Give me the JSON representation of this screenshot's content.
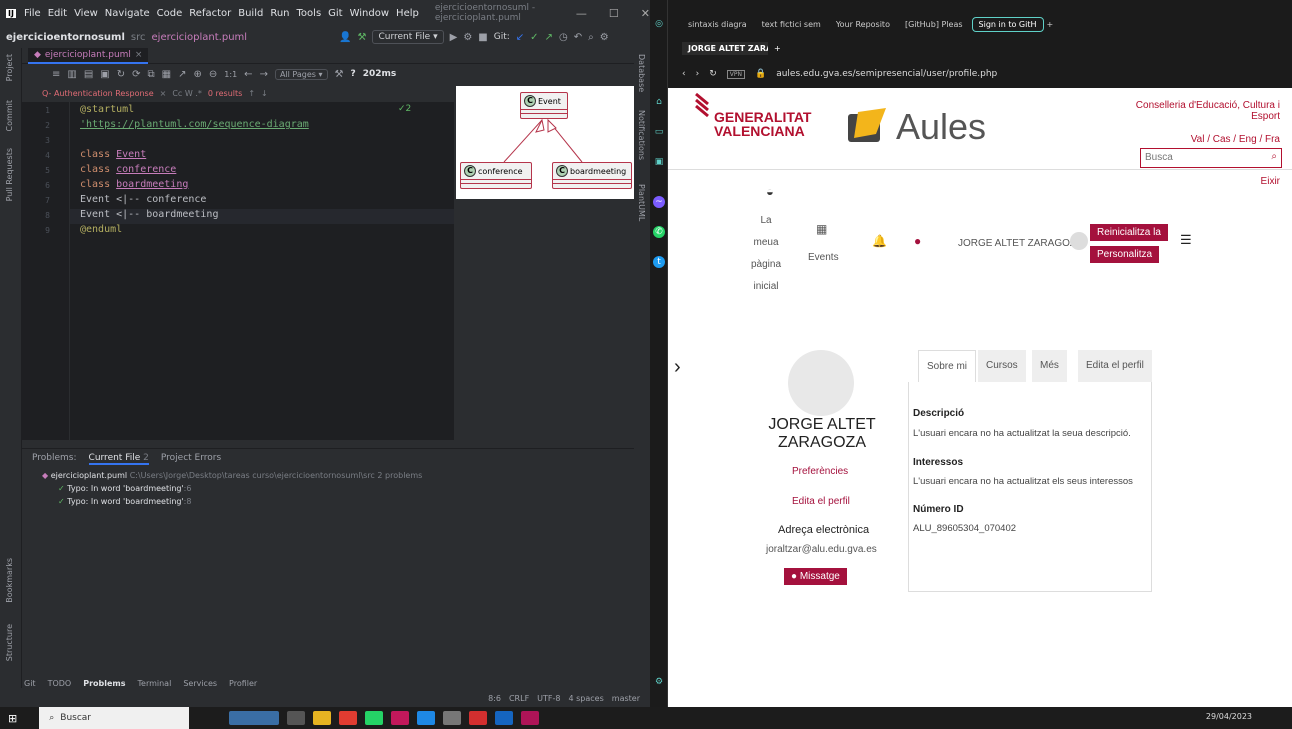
{
  "ide": {
    "menu": [
      "File",
      "Edit",
      "View",
      "Navigate",
      "Code",
      "Refactor",
      "Build",
      "Run",
      "Tools",
      "Git",
      "Window",
      "Help"
    ],
    "window_title": "ejercicioentornosuml - ejercicioplant.puml",
    "project": "ejercicioentornosuml",
    "src": "src",
    "file": "ejercicioplant.puml",
    "current_file": "Current File",
    "git_label": "Git:",
    "tab": "ejercicioplant.puml",
    "all_pages": "All Pages",
    "zoom": "?",
    "render_time": "202ms",
    "search_query": "Q- Authentication Response",
    "search_opts": "Cc W .*",
    "search_results": "0 results",
    "lines": [
      {
        "n": "1",
        "t": "@startuml",
        "c": "ann"
      },
      {
        "n": "2",
        "t": "'https://plantuml.com/sequence-diagram",
        "c": "str"
      },
      {
        "n": "3",
        "t": "",
        "c": "pl"
      },
      {
        "n": "4",
        "t": "class ",
        "c": "kw",
        "x": "Event"
      },
      {
        "n": "5",
        "t": "class ",
        "c": "kw",
        "x": "conference"
      },
      {
        "n": "6",
        "t": "class ",
        "c": "kw",
        "x": "boardmeeting"
      },
      {
        "n": "7",
        "t": "Event <|-- conference",
        "c": "pl"
      },
      {
        "n": "8",
        "t": "Event <|-- boardmeeting",
        "c": "pl"
      },
      {
        "n": "9",
        "t": "@enduml",
        "c": "ann"
      }
    ],
    "checks": "✓2",
    "diagram": {
      "event": "Event",
      "conference": "conference",
      "boardmeeting": "boardmeeting",
      "class_letter": "C"
    },
    "problems": {
      "label": "Problems:",
      "tab_current": "Current File",
      "current_count": "2",
      "tab_project": "Project Errors",
      "file_row": "ejercicioplant.puml",
      "file_path": "C:\\Users\\Jorge\\Desktop\\tareas curso\\ejercicioentornosuml\\src",
      "file_count": "2 problems",
      "items": [
        {
          "msg": "Typo: In word 'boardmeeting'",
          "loc": ":6"
        },
        {
          "msg": "Typo: In word 'boardmeeting'",
          "loc": ":8"
        }
      ]
    },
    "bottom_tabs": [
      "Git",
      "TODO",
      "Problems",
      "Terminal",
      "Services",
      "Profiler"
    ],
    "status": [
      "8:6",
      "CRLF",
      "UTF-8",
      "4 spaces",
      "master"
    ],
    "left_labels": [
      "Project",
      "Commit",
      "Pull Requests",
      "Bookmarks",
      "Structure"
    ],
    "right_labels": [
      "Database",
      "Notifications",
      "PlantUML"
    ]
  },
  "browser": {
    "tabs": [
      "sintaxis diagra",
      "text fictici sem",
      "Your Reposito",
      "[GitHub] Pleas",
      "Sign in to GitH"
    ],
    "tab2": "JORGE ALTET ZARAGOZA: P",
    "url": "aules.edu.gva.es/semipresencial/user/profile.php",
    "vpn": "VPN"
  },
  "site": {
    "gv_line1": "GENERALITAT",
    "gv_line2": "VALENCIANA",
    "aules": "Aules",
    "conselleria": "Conselleria d'Educació, Cultura i Esport",
    "langs": "Val / Cas / Eng / Fra",
    "search_placeholder": "Busca",
    "eixir": "Eixir",
    "home": [
      "La",
      "meua",
      "pàgina",
      "inicial"
    ],
    "events": "Events",
    "user": "JORGE ALTET ZARAGOZA",
    "reset": "Reinicialitza la",
    "customize": "Personalitza",
    "name1": "JORGE ALTET",
    "name2": "ZARAGOZA",
    "prefs": "Preferències",
    "edit_profile": "Edita el perfil",
    "email_label": "Adreça electrònica",
    "email": "joraltzar@alu.edu.gva.es",
    "message": "Missatge",
    "profile_tabs": [
      "Sobre mi",
      "Cursos",
      "Més",
      "Edita el perfil"
    ],
    "desc_h": "Descripció",
    "desc": "L'usuari encara no ha actualitzat la seua descripció.",
    "int_h": "Interessos",
    "int": "L'usuari encara no ha actualitzat els seus interessos",
    "id_h": "Número ID",
    "id": "ALU_89605304_070402"
  },
  "taskbar": {
    "search": "Buscar",
    "date": "29/04/2023"
  }
}
